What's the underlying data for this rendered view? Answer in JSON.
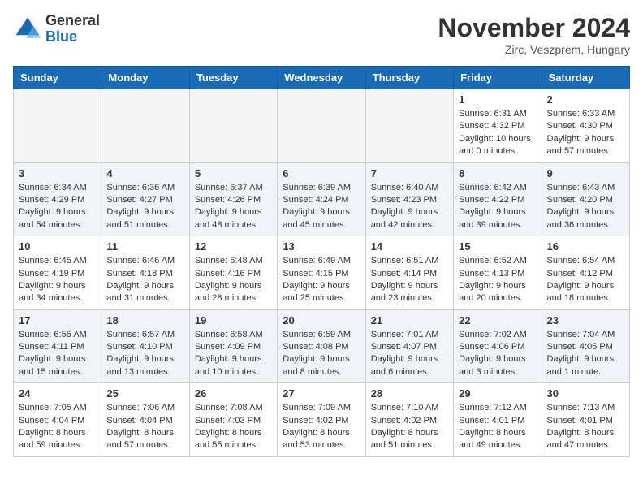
{
  "header": {
    "logo_general": "General",
    "logo_blue": "Blue",
    "month_title": "November 2024",
    "location": "Zirc, Veszprem, Hungary"
  },
  "weekdays": [
    "Sunday",
    "Monday",
    "Tuesday",
    "Wednesday",
    "Thursday",
    "Friday",
    "Saturday"
  ],
  "weeks": [
    [
      {
        "day": "",
        "info": ""
      },
      {
        "day": "",
        "info": ""
      },
      {
        "day": "",
        "info": ""
      },
      {
        "day": "",
        "info": ""
      },
      {
        "day": "",
        "info": ""
      },
      {
        "day": "1",
        "info": "Sunrise: 6:31 AM\nSunset: 4:32 PM\nDaylight: 10 hours\nand 0 minutes."
      },
      {
        "day": "2",
        "info": "Sunrise: 6:33 AM\nSunset: 4:30 PM\nDaylight: 9 hours\nand 57 minutes."
      }
    ],
    [
      {
        "day": "3",
        "info": "Sunrise: 6:34 AM\nSunset: 4:29 PM\nDaylight: 9 hours\nand 54 minutes."
      },
      {
        "day": "4",
        "info": "Sunrise: 6:36 AM\nSunset: 4:27 PM\nDaylight: 9 hours\nand 51 minutes."
      },
      {
        "day": "5",
        "info": "Sunrise: 6:37 AM\nSunset: 4:26 PM\nDaylight: 9 hours\nand 48 minutes."
      },
      {
        "day": "6",
        "info": "Sunrise: 6:39 AM\nSunset: 4:24 PM\nDaylight: 9 hours\nand 45 minutes."
      },
      {
        "day": "7",
        "info": "Sunrise: 6:40 AM\nSunset: 4:23 PM\nDaylight: 9 hours\nand 42 minutes."
      },
      {
        "day": "8",
        "info": "Sunrise: 6:42 AM\nSunset: 4:22 PM\nDaylight: 9 hours\nand 39 minutes."
      },
      {
        "day": "9",
        "info": "Sunrise: 6:43 AM\nSunset: 4:20 PM\nDaylight: 9 hours\nand 36 minutes."
      }
    ],
    [
      {
        "day": "10",
        "info": "Sunrise: 6:45 AM\nSunset: 4:19 PM\nDaylight: 9 hours\nand 34 minutes."
      },
      {
        "day": "11",
        "info": "Sunrise: 6:46 AM\nSunset: 4:18 PM\nDaylight: 9 hours\nand 31 minutes."
      },
      {
        "day": "12",
        "info": "Sunrise: 6:48 AM\nSunset: 4:16 PM\nDaylight: 9 hours\nand 28 minutes."
      },
      {
        "day": "13",
        "info": "Sunrise: 6:49 AM\nSunset: 4:15 PM\nDaylight: 9 hours\nand 25 minutes."
      },
      {
        "day": "14",
        "info": "Sunrise: 6:51 AM\nSunset: 4:14 PM\nDaylight: 9 hours\nand 23 minutes."
      },
      {
        "day": "15",
        "info": "Sunrise: 6:52 AM\nSunset: 4:13 PM\nDaylight: 9 hours\nand 20 minutes."
      },
      {
        "day": "16",
        "info": "Sunrise: 6:54 AM\nSunset: 4:12 PM\nDaylight: 9 hours\nand 18 minutes."
      }
    ],
    [
      {
        "day": "17",
        "info": "Sunrise: 6:55 AM\nSunset: 4:11 PM\nDaylight: 9 hours\nand 15 minutes."
      },
      {
        "day": "18",
        "info": "Sunrise: 6:57 AM\nSunset: 4:10 PM\nDaylight: 9 hours\nand 13 minutes."
      },
      {
        "day": "19",
        "info": "Sunrise: 6:58 AM\nSunset: 4:09 PM\nDaylight: 9 hours\nand 10 minutes."
      },
      {
        "day": "20",
        "info": "Sunrise: 6:59 AM\nSunset: 4:08 PM\nDaylight: 9 hours\nand 8 minutes."
      },
      {
        "day": "21",
        "info": "Sunrise: 7:01 AM\nSunset: 4:07 PM\nDaylight: 9 hours\nand 6 minutes."
      },
      {
        "day": "22",
        "info": "Sunrise: 7:02 AM\nSunset: 4:06 PM\nDaylight: 9 hours\nand 3 minutes."
      },
      {
        "day": "23",
        "info": "Sunrise: 7:04 AM\nSunset: 4:05 PM\nDaylight: 9 hours\nand 1 minute."
      }
    ],
    [
      {
        "day": "24",
        "info": "Sunrise: 7:05 AM\nSunset: 4:04 PM\nDaylight: 8 hours\nand 59 minutes."
      },
      {
        "day": "25",
        "info": "Sunrise: 7:06 AM\nSunset: 4:04 PM\nDaylight: 8 hours\nand 57 minutes."
      },
      {
        "day": "26",
        "info": "Sunrise: 7:08 AM\nSunset: 4:03 PM\nDaylight: 8 hours\nand 55 minutes."
      },
      {
        "day": "27",
        "info": "Sunrise: 7:09 AM\nSunset: 4:02 PM\nDaylight: 8 hours\nand 53 minutes."
      },
      {
        "day": "28",
        "info": "Sunrise: 7:10 AM\nSunset: 4:02 PM\nDaylight: 8 hours\nand 51 minutes."
      },
      {
        "day": "29",
        "info": "Sunrise: 7:12 AM\nSunset: 4:01 PM\nDaylight: 8 hours\nand 49 minutes."
      },
      {
        "day": "30",
        "info": "Sunrise: 7:13 AM\nSunset: 4:01 PM\nDaylight: 8 hours\nand 47 minutes."
      }
    ]
  ]
}
